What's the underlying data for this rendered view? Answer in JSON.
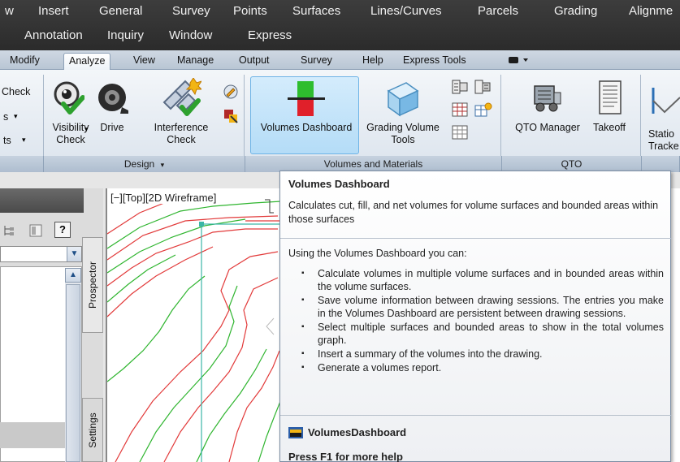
{
  "menubar": {
    "row1": [
      "w",
      "Insert",
      "General",
      "Survey",
      "Points",
      "Surfaces",
      "Lines/Curves",
      "Parcels",
      "Grading",
      "Alignme"
    ],
    "row2": [
      "Annotation",
      "Inquiry",
      "Window",
      "Express"
    ]
  },
  "tabs": [
    "Modify",
    "Analyze",
    "View",
    "Manage",
    "Output",
    "Survey",
    "Help",
    "Express Tools"
  ],
  "ribbon": {
    "left_labels": [
      "Check",
      "s",
      "ts"
    ],
    "visibility_check": "Visibility\nCheck",
    "drive": "Drive",
    "interference_check": "Interference\nCheck",
    "volumes_dashboard": "Volumes Dashboard",
    "grading_volume_tools": "Grading Volume\nTools",
    "qto_manager": "QTO Manager",
    "takeoff": "Takeoff",
    "station_tracker": "Statio\nTracke",
    "panel_design": "Design",
    "panel_volumes": "Volumes and Materials",
    "panel_qto": "QTO"
  },
  "palette": {
    "help_glyph": "?",
    "prospector": "Prospector",
    "settings": "Settings"
  },
  "viewport_label": "[−][Top][2D Wireframe]",
  "tooltip": {
    "title": "Volumes Dashboard",
    "description": "Calculates cut, fill, and net volumes for volume surfaces and bounded areas within those surfaces",
    "intro": "Using the Volumes Dashboard you can:",
    "items": [
      "Calculate volumes in multiple volume surfaces and in bounded areas within the volume surfaces.",
      "Save volume information between drawing sessions. The entries you make in the Volumes Dashboard are persistent between drawing sessions.",
      "Select multiple surfaces and bounded areas to show in the total volumes graph.",
      "Insert a summary of the volumes into the drawing.",
      "Generate a volumes report."
    ],
    "command": "VolumesDashboard",
    "help": "Press F1 for more help"
  },
  "colors": {
    "accent_green": "#2ebd2e",
    "accent_red": "#e0202a",
    "contour_red": "#e23a3a",
    "contour_green": "#2fb52f"
  }
}
